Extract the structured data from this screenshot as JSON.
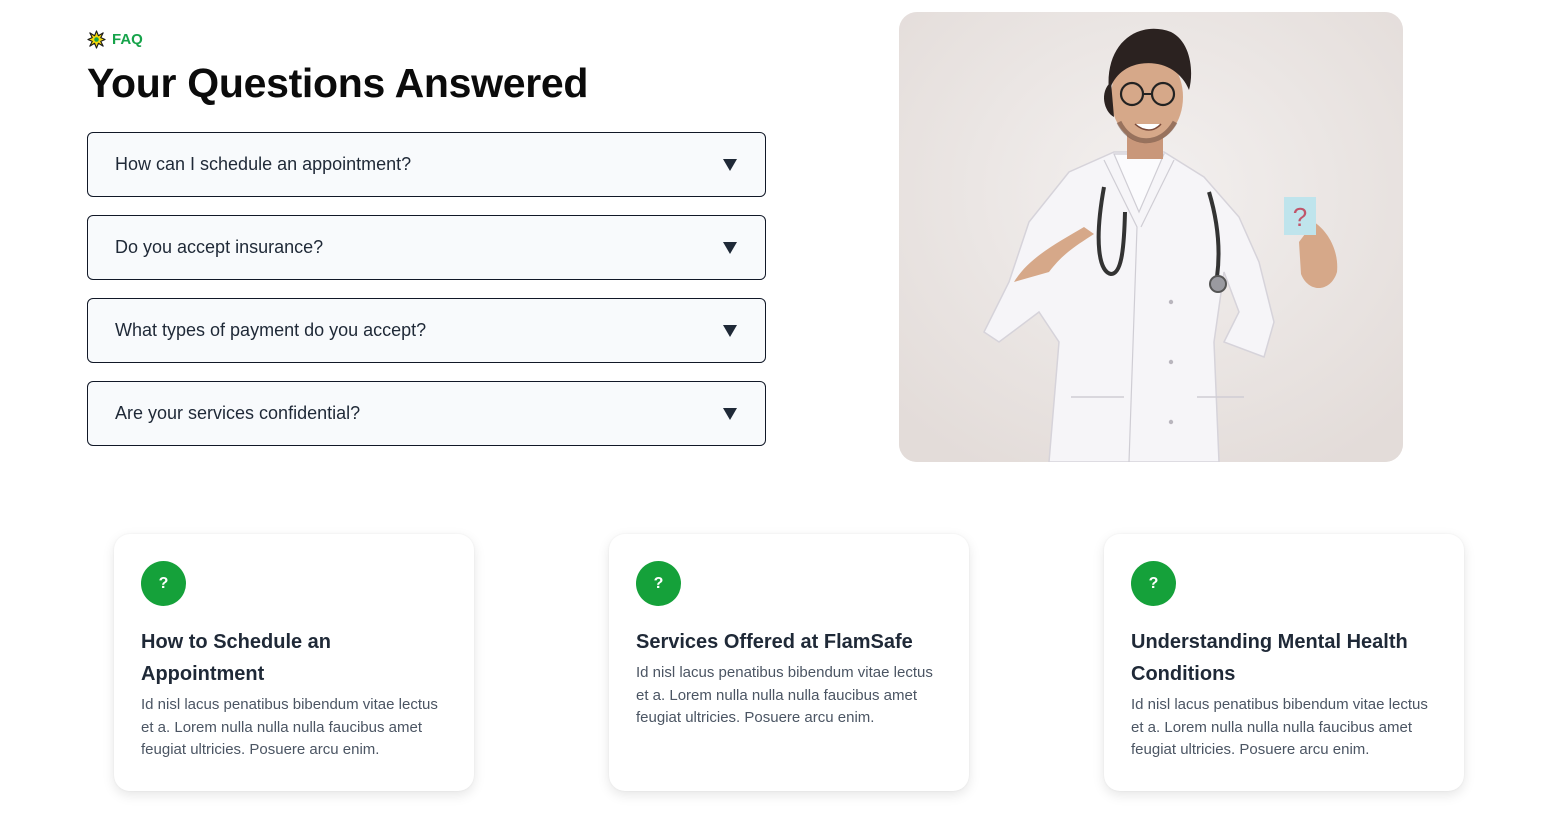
{
  "section": {
    "tag_label": "FAQ",
    "title": "Your Questions Answered"
  },
  "faq": {
    "items": [
      {
        "question": "How can I schedule an appointment?"
      },
      {
        "question": "Do you accept insurance?"
      },
      {
        "question": "What types of payment do you accept?"
      },
      {
        "question": "Are your services confidential?"
      }
    ]
  },
  "hero": {
    "icon": "doctor-photo",
    "note_glyph": "?"
  },
  "cards": [
    {
      "icon_glyph": "?",
      "title": "How to Schedule an Appointment",
      "body": "Id nisl lacus penatibus bibendum vitae lectus et a. Lorem nulla nulla nulla faucibus amet feugiat ultricies. Posuere arcu enim."
    },
    {
      "icon_glyph": "?",
      "title": "Services Offered at FlamSafe",
      "body": "Id nisl lacus penatibus bibendum vitae lectus et a. Lorem nulla nulla nulla faucibus amet feugiat ultricies. Posuere arcu enim."
    },
    {
      "icon_glyph": "?",
      "title": "Understanding Mental Health Conditions",
      "body": "Id nisl lacus penatibus bibendum vitae lectus et a. Lorem nulla nulla nulla faucibus amet feugiat ultricies. Posuere arcu enim."
    }
  ],
  "colors": {
    "accent": "#16a34a",
    "icon_bg": "#15a13a",
    "heading": "#0b0b0b",
    "border": "#111827"
  }
}
